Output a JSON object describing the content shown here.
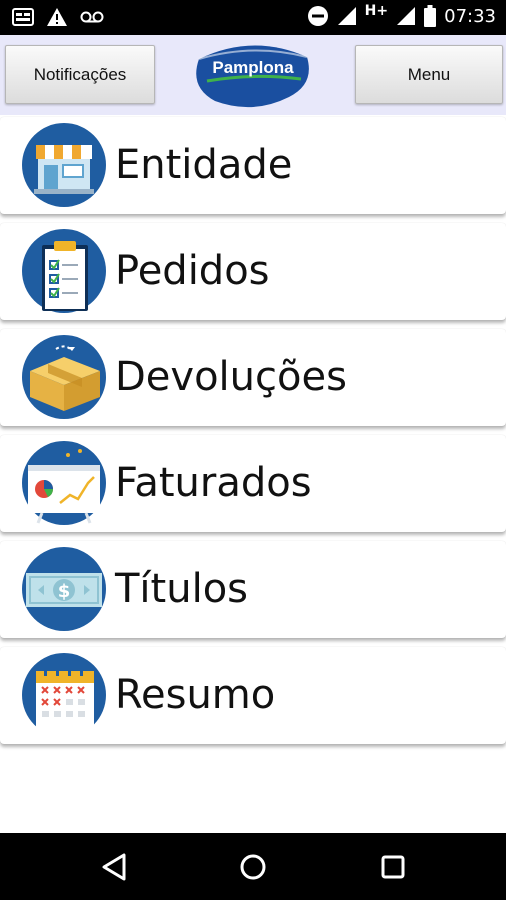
{
  "status_bar": {
    "time": "07:33",
    "network": "H+",
    "left_icons": [
      "notification-icon",
      "alert-icon",
      "voicemail-icon"
    ],
    "right_icons": [
      "do-not-disturb-icon",
      "signal-icon",
      "battery-icon"
    ]
  },
  "header": {
    "left_button": "Notificações",
    "right_button": "Menu",
    "logo_text": "Pamplona",
    "background": "#e8e8fa"
  },
  "menu": {
    "items": [
      {
        "label": "Entidade",
        "icon": "storefront-icon"
      },
      {
        "label": "Pedidos",
        "icon": "clipboard-checklist-icon"
      },
      {
        "label": "Devoluções",
        "icon": "package-box-icon"
      },
      {
        "label": "Faturados",
        "icon": "presentation-chart-icon"
      },
      {
        "label": "Títulos",
        "icon": "banknote-icon"
      },
      {
        "label": "Resumo",
        "icon": "calendar-icon"
      }
    ]
  },
  "nav_bar": {
    "buttons": [
      "back-icon",
      "home-icon",
      "recents-icon"
    ]
  },
  "colors": {
    "icon_circle": "#1f5da1",
    "logo_blue": "#1a4fa0",
    "logo_green": "#3fb24a"
  }
}
